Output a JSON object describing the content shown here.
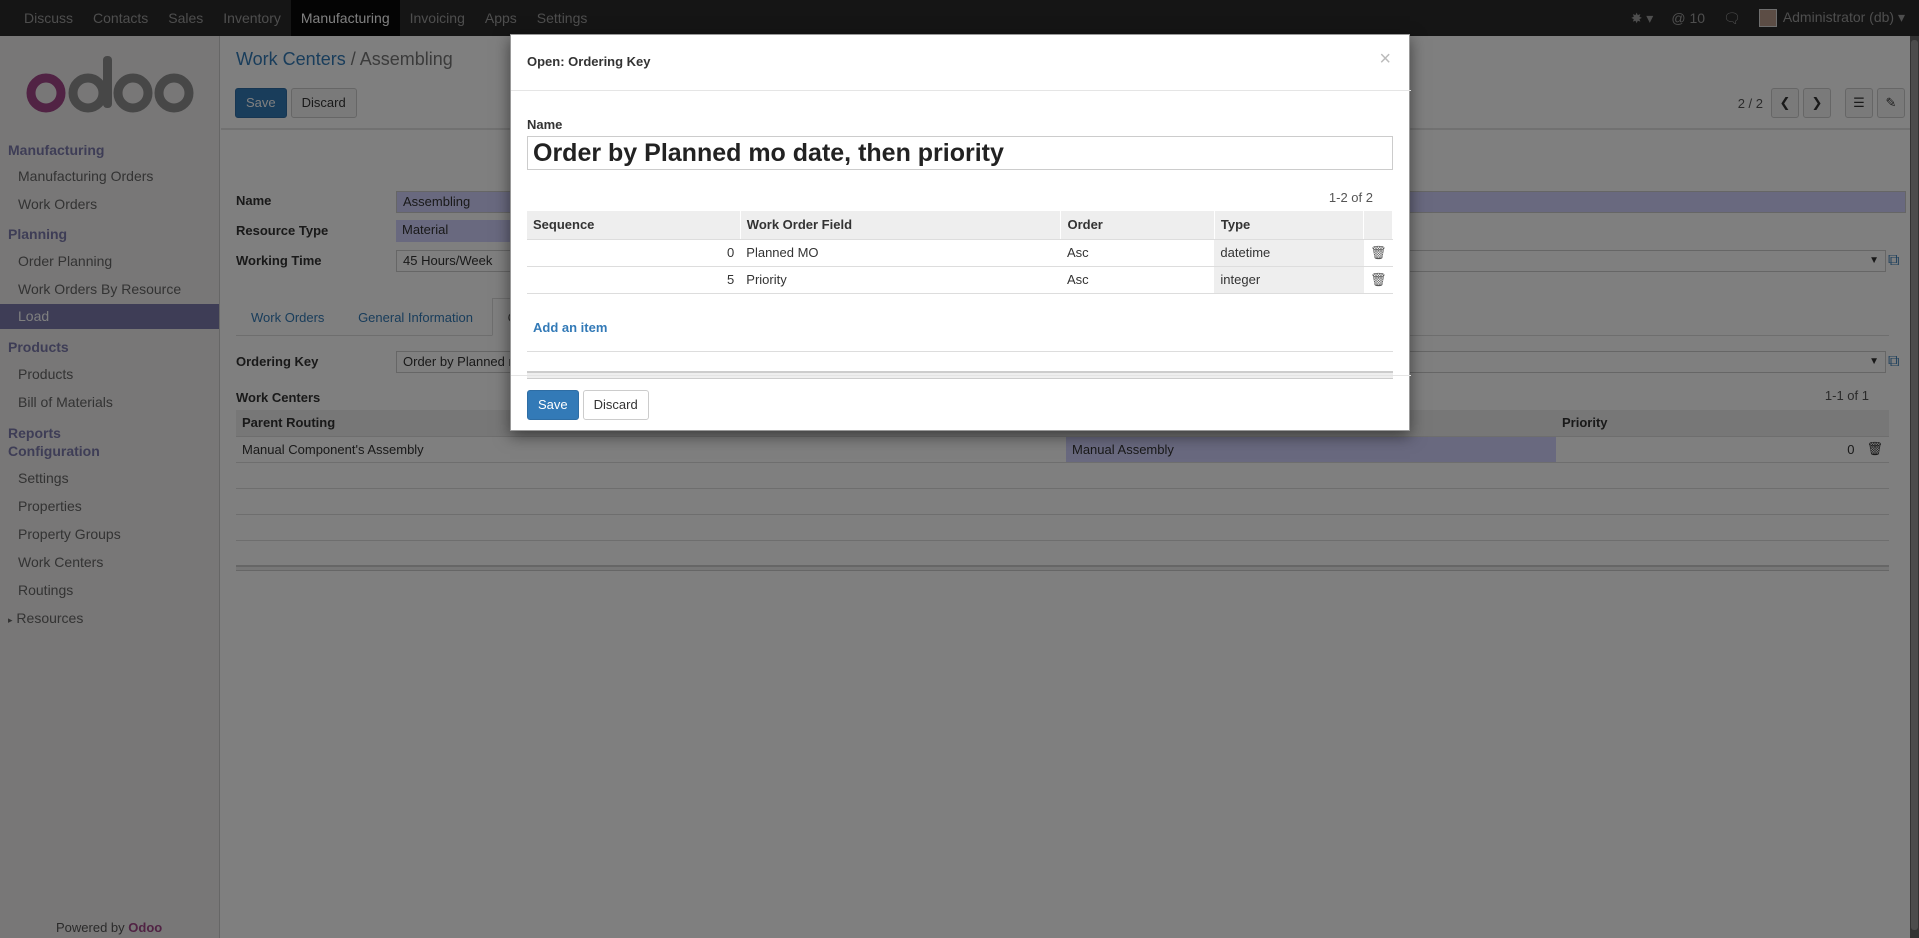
{
  "topbar": {
    "apps": [
      "Discuss",
      "Contacts",
      "Sales",
      "Inventory",
      "Manufacturing",
      "Invoicing",
      "Apps",
      "Settings"
    ],
    "active_app": "Manufacturing",
    "bug_icon": "bug-icon",
    "mentions": "@ 10",
    "chat_icon": "chat-icon",
    "user": "Administrator (db)"
  },
  "sidebar": {
    "logo": "odoo",
    "sections": {
      "manufacturing": "Manufacturing",
      "planning": "Planning",
      "products": "Products",
      "reports": "Reports",
      "configuration": "Configuration"
    },
    "items": {
      "manufacturing_orders": "Manufacturing Orders",
      "work_orders": "Work Orders",
      "order_planning": "Order Planning",
      "work_orders_by_resource": "Work Orders By Resource",
      "load": "Load",
      "products": "Products",
      "bill_of_materials": "Bill of Materials",
      "settings": "Settings",
      "properties": "Properties",
      "property_groups": "Property Groups",
      "work_centers": "Work Centers",
      "routings": "Routings",
      "resources": "Resources"
    },
    "powered_by": "Powered by",
    "powered_brand": "Odoo"
  },
  "main": {
    "breadcrumb_parent": "Work Centers",
    "breadcrumb_sep": "/",
    "breadcrumb_current": "Assembling",
    "save_label": "Save",
    "discard_label": "Discard",
    "pager": "2 / 2",
    "form": {
      "name_label": "Name",
      "name_value": "Assembling",
      "resource_type_label": "Resource Type",
      "resource_type_value": "Material",
      "working_time_label": "Working Time",
      "working_time_value": "45 Hours/Week",
      "tabs": [
        "Work Orders",
        "General Information",
        "C"
      ],
      "ordering_key_label": "Ordering Key",
      "ordering_key_value": "Order by Planned m",
      "work_centers_label": "Work Centers"
    },
    "subtable": {
      "count": "1-1 of 1",
      "columns": [
        "Parent Routing",
        "",
        "Priority"
      ],
      "rows": [
        {
          "parent_routing": "Manual Component's Assembly",
          "routing": "Manual Assembly",
          "priority": "0"
        }
      ]
    }
  },
  "modal": {
    "title": "Open: Ordering Key",
    "close": "×",
    "name_label": "Name",
    "name_value": "Order by Planned mo date, then priority",
    "count": "1-2 of 2",
    "columns": [
      "Sequence",
      "Work Order Field",
      "Order",
      "Type"
    ],
    "rows": [
      {
        "sequence": "0",
        "field": "Planned MO",
        "order": "Asc",
        "type": "datetime"
      },
      {
        "sequence": "5",
        "field": "Priority",
        "order": "Asc",
        "type": "integer"
      }
    ],
    "add_item": "Add an item",
    "save_label": "Save",
    "discard_label": "Discard"
  },
  "colors": {
    "navbar": "#2a2a2a",
    "brand": "#7c7bad",
    "primary": "#337ab7",
    "required_field": "#d2d2ff"
  }
}
